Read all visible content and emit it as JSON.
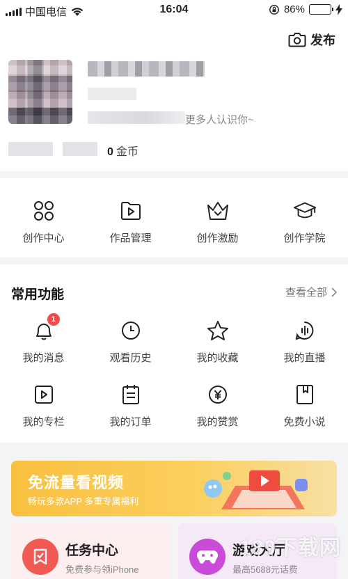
{
  "status_bar": {
    "carrier": "中国电信",
    "time": "16:04",
    "battery_percent": "86%",
    "battery_level": 0.86
  },
  "header": {
    "publish_label": "发布"
  },
  "profile": {
    "signature_tail": "更多人认识你~",
    "coins_value": "0",
    "coins_unit": "金币"
  },
  "creator_tools": [
    {
      "label": "创作中心",
      "icon": "grid-four-icon"
    },
    {
      "label": "作品管理",
      "icon": "folder-play-icon"
    },
    {
      "label": "创作激励",
      "icon": "crown-icon"
    },
    {
      "label": "创作学院",
      "icon": "graduation-cap-icon"
    }
  ],
  "common": {
    "title": "常用功能",
    "view_all": "查看全部",
    "items": [
      {
        "label": "我的消息",
        "icon": "bell-icon",
        "badge": "1"
      },
      {
        "label": "观看历史",
        "icon": "clock-icon"
      },
      {
        "label": "我的收藏",
        "icon": "star-icon"
      },
      {
        "label": "我的直播",
        "icon": "live-icon"
      },
      {
        "label": "我的专栏",
        "icon": "column-play-icon"
      },
      {
        "label": "我的订单",
        "icon": "clipboard-icon"
      },
      {
        "label": "我的赞赏",
        "icon": "yen-coin-icon"
      },
      {
        "label": "免费小说",
        "icon": "book-icon"
      }
    ]
  },
  "promo": {
    "title": "免流量看视频",
    "subtitle": "畅玩多款APP 多重专属福利"
  },
  "cards": {
    "task_title": "任务中心",
    "task_sub": "免费参与领iPhone",
    "game_title": "游戏大厅",
    "game_sub": "最高5688元话费"
  },
  "watermark": {
    "text": "189下载网"
  },
  "colors": {
    "badge": "#f04a4a",
    "battery": "#3cc13b",
    "promo": "#f9c040",
    "task_icon": "#f15a52",
    "game_icon": "#c94bd8"
  }
}
